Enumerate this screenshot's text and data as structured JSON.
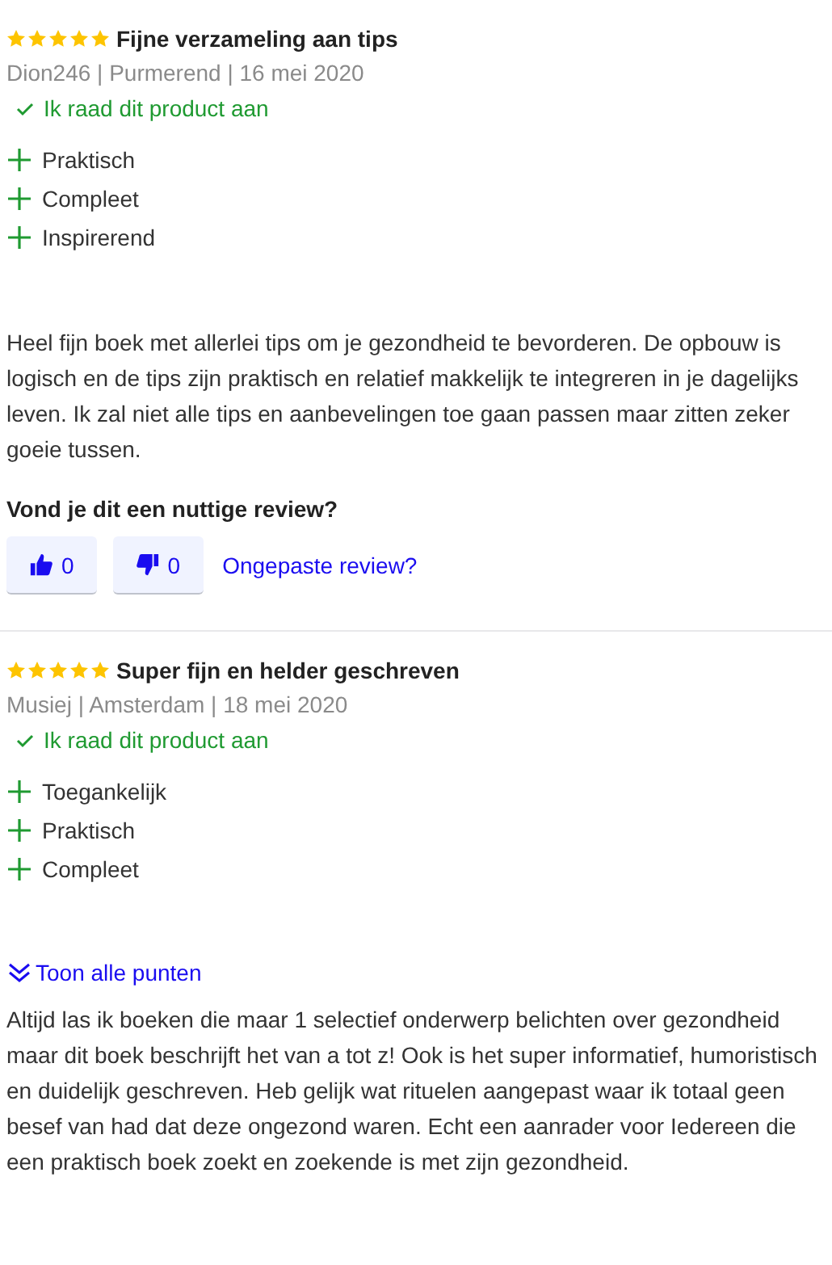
{
  "reviews": [
    {
      "stars": 5,
      "title": "Fijne verzameling aan tips",
      "meta": "Dion246 | Purmerend | 16 mei 2020",
      "recommend": "Ik raad dit product aan",
      "pros": [
        "Praktisch",
        "Compleet",
        "Inspirerend"
      ],
      "body": "Heel fijn boek met allerlei tips om je gezondheid te bevorderen. De opbouw is logisch en de tips zijn praktisch en relatief makkelijk te integreren in je dagelijks leven. Ik zal niet alle tips en aanbevelingen toe gaan passen maar zitten zeker goeie tussen.",
      "feedback": {
        "question": "Vond je dit een nuttige review?",
        "up": "0",
        "down": "0",
        "report": "Ongepaste review?"
      }
    },
    {
      "stars": 5,
      "title": "Super fijn en helder geschreven",
      "meta": "Musiej | Amsterdam | 18 mei 2020",
      "recommend": "Ik raad dit product aan",
      "pros": [
        "Toegankelijk",
        "Praktisch",
        "Compleet"
      ],
      "show_all": "Toon alle punten",
      "body": "Altijd las ik boeken die maar 1 selectief onderwerp belichten over gezondheid maar dit boek beschrijft het van a tot z! Ook is het super informatief, humoristisch en duidelijk geschreven. Heb gelijk wat rituelen aangepast waar ik totaal geen besef van had dat deze ongezond waren. Echt een aanrader voor Iedereen die een praktisch boek zoekt en zoekende is met zijn gezondheid."
    }
  ]
}
